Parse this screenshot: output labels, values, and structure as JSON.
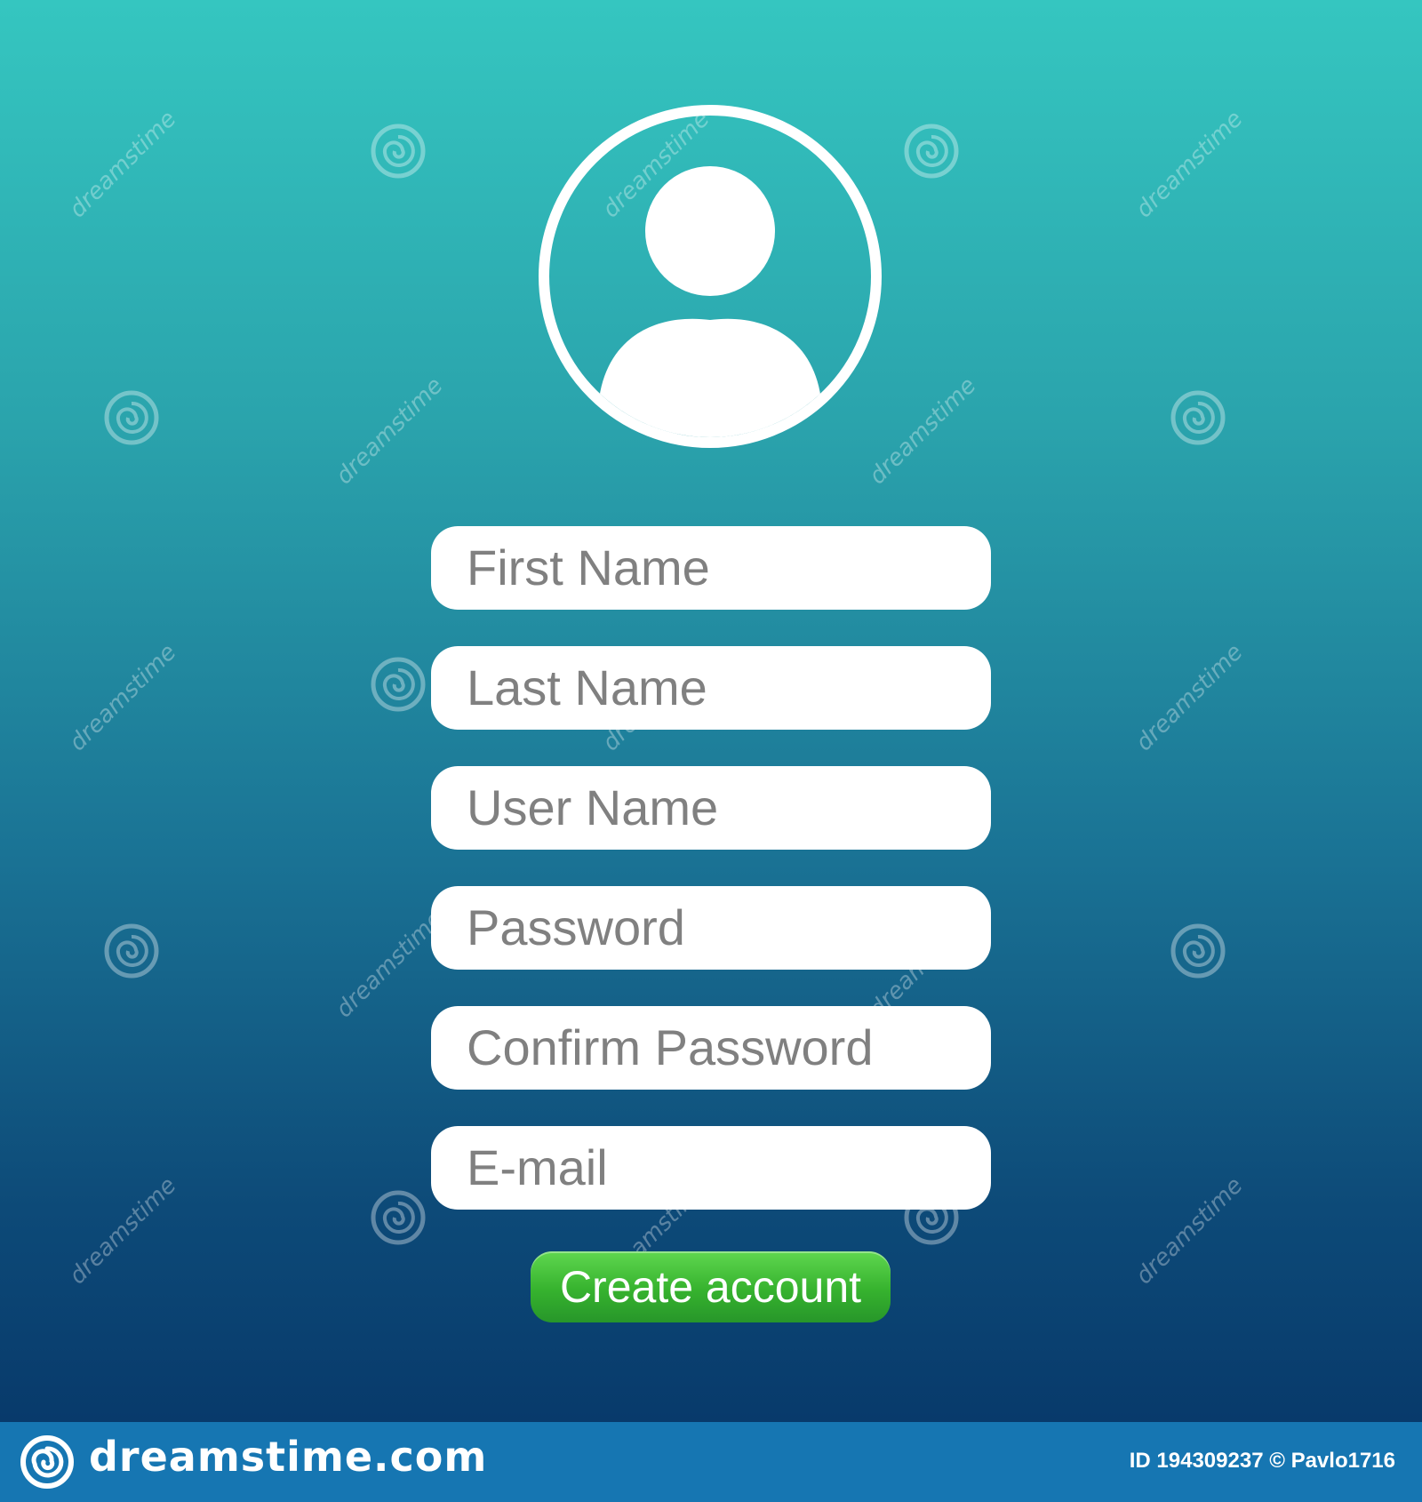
{
  "colors": {
    "background_top": "#35c6c0",
    "background_bottom": "#083a6b",
    "field_background": "#ffffff",
    "field_text": "#808080",
    "button_green": "#36b22e",
    "footer_bar": "#1676b2"
  },
  "avatar": {
    "icon": "user-avatar-icon"
  },
  "form": {
    "fields": [
      {
        "placeholder": "First Name"
      },
      {
        "placeholder": "Last Name"
      },
      {
        "placeholder": "User Name"
      },
      {
        "placeholder": "Password"
      },
      {
        "placeholder": "Confirm Password"
      },
      {
        "placeholder": "E-mail"
      }
    ],
    "submit_label": "Create account"
  },
  "watermark": {
    "brand": "dreamstime.com",
    "repeated_text": "dreamstime",
    "image_id_text": "ID 194309237 © Pavlo1716"
  }
}
